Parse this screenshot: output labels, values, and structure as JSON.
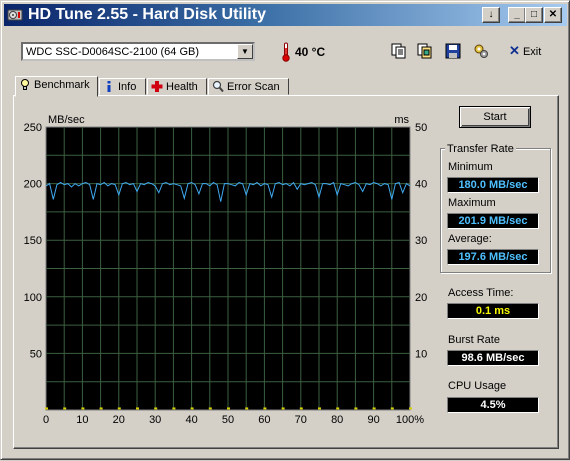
{
  "window": {
    "title": "HD Tune 2.55 - Hard Disk Utility",
    "title_buttons": [
      "↓",
      "_",
      "□",
      "✕"
    ]
  },
  "toolbar": {
    "drive_select": "WDC SSC-D0064SC-2100 (64 GB)",
    "temperature": "40 °C",
    "icons": [
      "copy-text-icon",
      "copy-screenshot-icon",
      "save-icon",
      "options-icon"
    ],
    "exit_label": "Exit"
  },
  "tabs": [
    {
      "label": "Benchmark",
      "icon": "lightbulb-icon",
      "active": true
    },
    {
      "label": "Info",
      "icon": "info-icon",
      "active": false
    },
    {
      "label": "Health",
      "icon": "health-cross-icon",
      "active": false
    },
    {
      "label": "Error Scan",
      "icon": "magnifier-icon",
      "active": false
    }
  ],
  "benchmark": {
    "start_label": "Start",
    "transfer_rate": {
      "title": "Transfer Rate",
      "minimum_label": "Minimum",
      "minimum_value": "180.0 MB/sec",
      "maximum_label": "Maximum",
      "maximum_value": "201.9 MB/sec",
      "average_label": "Average:",
      "average_value": "197.6 MB/sec"
    },
    "access_time_label": "Access Time:",
    "access_time_value": "0.1 ms",
    "burst_rate_label": "Burst Rate",
    "burst_rate_value": "98.6 MB/sec",
    "cpu_usage_label": "CPU Usage",
    "cpu_usage_value": "4.5%"
  },
  "colors": {
    "transfer_line": "#3fa8f0",
    "access_points": "#d8d000",
    "value_cyan": "#4ec0ff",
    "value_yellow": "#f8f800",
    "value_white": "#ffffff",
    "grid": "#3c6040"
  },
  "chart_data": {
    "type": "line",
    "xlabel": "",
    "ylabel": "MB/sec",
    "y2label": "ms",
    "xlim": [
      0,
      100
    ],
    "ylim": [
      0,
      250
    ],
    "y2lim": [
      0,
      50
    ],
    "x_ticks": [
      "0",
      "10",
      "20",
      "30",
      "40",
      "50",
      "60",
      "70",
      "80",
      "90",
      "100%"
    ],
    "y_ticks": [
      "250",
      "200",
      "150",
      "100",
      "50"
    ],
    "y2_ticks": [
      "50",
      "40",
      "30",
      "20",
      "10"
    ],
    "grid": true,
    "series": [
      {
        "name": "",
        "x": [
          0,
          1,
          2,
          3,
          4,
          5,
          6,
          7,
          8,
          9,
          10,
          11,
          12,
          13,
          14,
          15,
          16,
          17,
          18,
          19,
          20,
          21,
          22,
          23,
          24,
          25,
          26,
          27,
          28,
          29,
          30,
          31,
          32,
          33,
          34,
          35,
          36,
          37,
          38,
          39,
          40,
          41,
          42,
          43,
          44,
          45,
          46,
          47,
          48,
          49,
          50,
          51,
          52,
          53,
          54,
          55,
          56,
          57,
          58,
          59,
          60,
          61,
          62,
          63,
          64,
          65,
          66,
          67,
          68,
          69,
          70,
          71,
          72,
          73,
          74,
          75,
          76,
          77,
          78,
          79,
          80,
          81,
          82,
          83,
          84,
          85,
          86,
          87,
          88,
          89,
          90,
          91,
          92,
          93,
          94,
          95,
          96,
          97,
          98,
          99,
          100
        ],
        "values": [
          198,
          200,
          186,
          199,
          201,
          199,
          200,
          197,
          200,
          198,
          200,
          201,
          199,
          186,
          200,
          199,
          201,
          198,
          200,
          199,
          190,
          200,
          201,
          199,
          200,
          193,
          200,
          199,
          201,
          200,
          198,
          192,
          200,
          201,
          199,
          200,
          199,
          198,
          187,
          200,
          201,
          199,
          191,
          200,
          200,
          198,
          201,
          199,
          184,
          200,
          200,
          199,
          198,
          201,
          200,
          190,
          200,
          199,
          201,
          198,
          200,
          199,
          188,
          200,
          201,
          199,
          200,
          198,
          201,
          195,
          200,
          199,
          200,
          201,
          199,
          188,
          200,
          200,
          199,
          201,
          190,
          200,
          199,
          198,
          200,
          201,
          199,
          193,
          200,
          199,
          201,
          200,
          198,
          200,
          199,
          186,
          200,
          201,
          192,
          200,
          198
        ]
      }
    ],
    "access_points_ms": [
      0.1,
      0.1,
      0.1,
      0.1,
      0.1,
      0.1,
      0.1,
      0.1,
      0.1,
      0.1,
      0.1,
      0.1,
      0.1,
      0.1,
      0.1,
      0.1,
      0.1,
      0.1,
      0.1,
      0.1,
      0.1
    ]
  }
}
